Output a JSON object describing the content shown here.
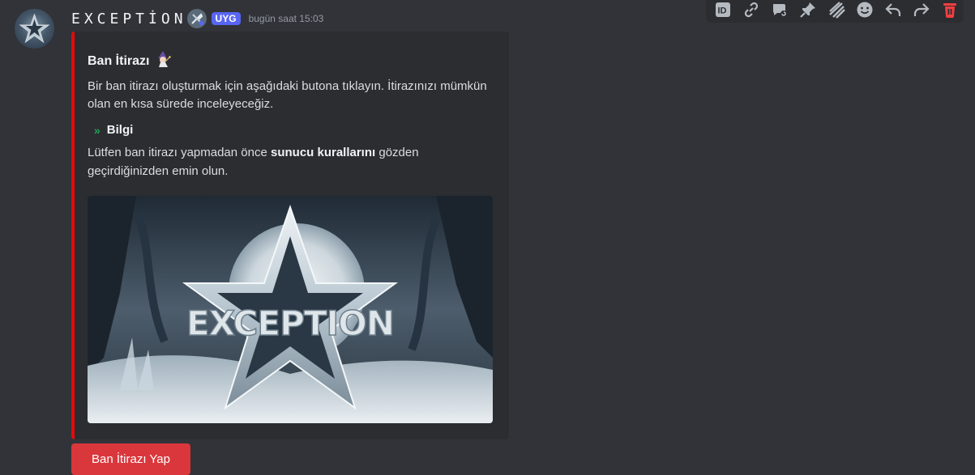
{
  "author": {
    "username": "EXCEPTİON",
    "tag": "UYG",
    "timestamp": "bugün saat 15:03"
  },
  "toolbar": {
    "icons": [
      "id-icon",
      "link-icon",
      "thread-icon",
      "pin-icon",
      "message-icon",
      "emoji-icon",
      "reply-icon",
      "forward-icon",
      "delete-icon"
    ],
    "delete_color": "#f23f42"
  },
  "embed": {
    "accent_color": "#e60a0a",
    "title": "Ban İtirazı",
    "title_emoji": "🧙",
    "description": "Bir ban itirazı oluşturmak için aşağıdaki butona tıklayın. İtirazınızı mümkün olan en kısa sürede inceleyeceğiz.",
    "field": {
      "chevron": "»",
      "name": "Bilgi",
      "value_pre": "Lütfen ban itirazı yapmadan önce ",
      "value_bold": "sunucu kurallarını",
      "value_post": " gözden geçirdiğinizden emin olun."
    },
    "image_text": "EXCEPTION"
  },
  "button": {
    "label": "Ban İtirazı Yap",
    "color": "#da373c"
  }
}
